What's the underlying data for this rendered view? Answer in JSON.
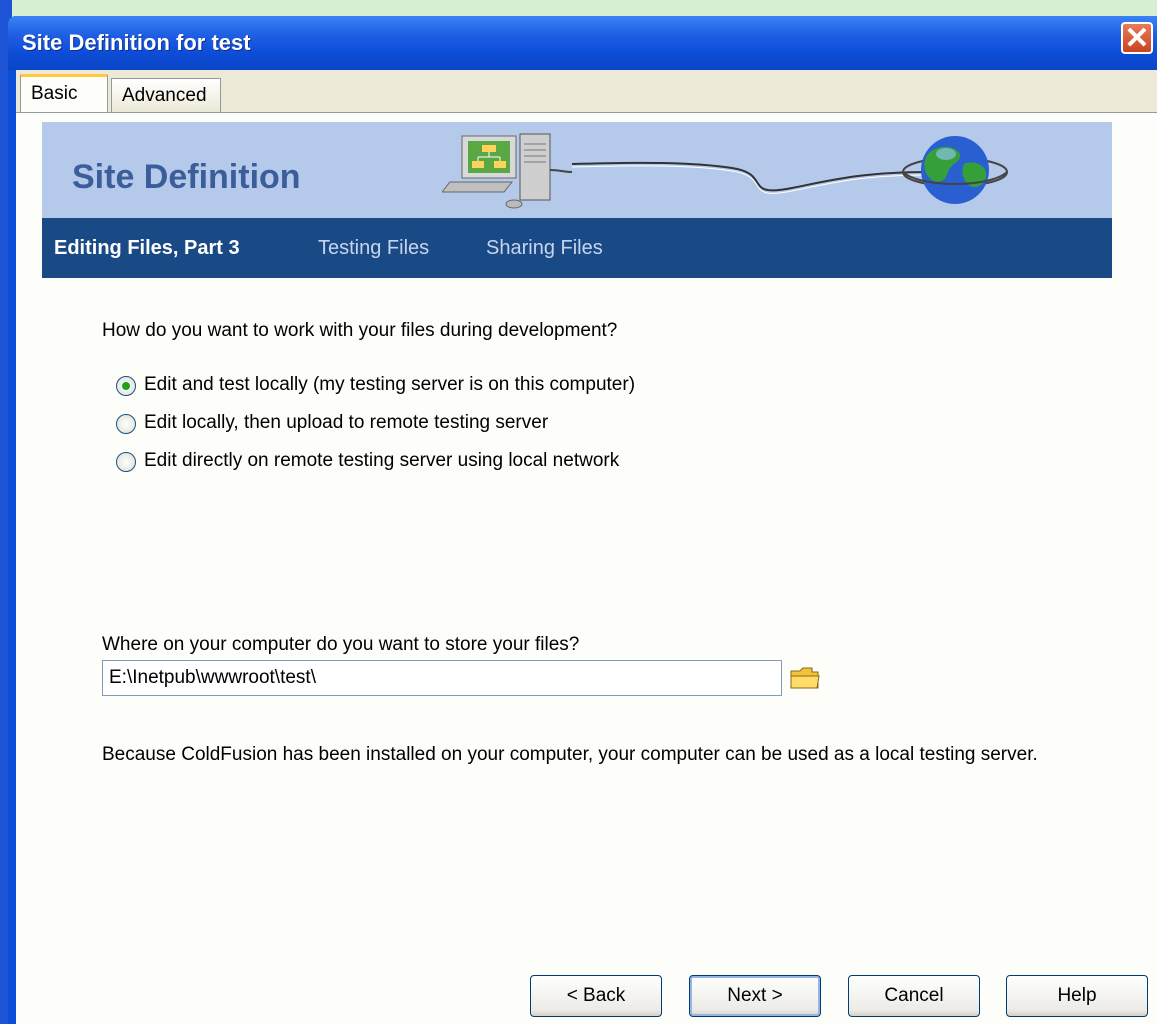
{
  "window": {
    "title": "Site Definition for test",
    "close_glyph": "✕"
  },
  "tabs": [
    {
      "label": "Basic",
      "active": true
    },
    {
      "label": "Advanced",
      "active": false
    }
  ],
  "header": {
    "title": "Site Definition",
    "icons": [
      "computer-network-icon",
      "globe-icon"
    ]
  },
  "steps": [
    {
      "label": "Editing Files, Part 3",
      "current": true
    },
    {
      "label": "Testing Files",
      "current": false
    },
    {
      "label": "Sharing Files",
      "current": false
    }
  ],
  "question1": "How do you want to work with your files during development?",
  "options": [
    {
      "label": "Edit and test locally (my testing server is on this computer)",
      "selected": true
    },
    {
      "label": "Edit locally, then upload to remote testing server",
      "selected": false
    },
    {
      "label": "Edit directly on remote testing server using local network",
      "selected": false
    }
  ],
  "question2": "Where on your computer do you want to store your files?",
  "path_value": "E:\\Inetpub\\wwwroot\\test\\",
  "note": "Because ColdFusion has been installed on your computer, your computer can be used as a local testing server.",
  "buttons": {
    "back": "< Back",
    "next": "Next >",
    "cancel": "Cancel",
    "help": "Help"
  },
  "colors": {
    "titlebar": "#0b4fd8",
    "stepbar": "#1a4a86",
    "header_band": "#b5c9ea",
    "radio_dot": "#21a121"
  }
}
